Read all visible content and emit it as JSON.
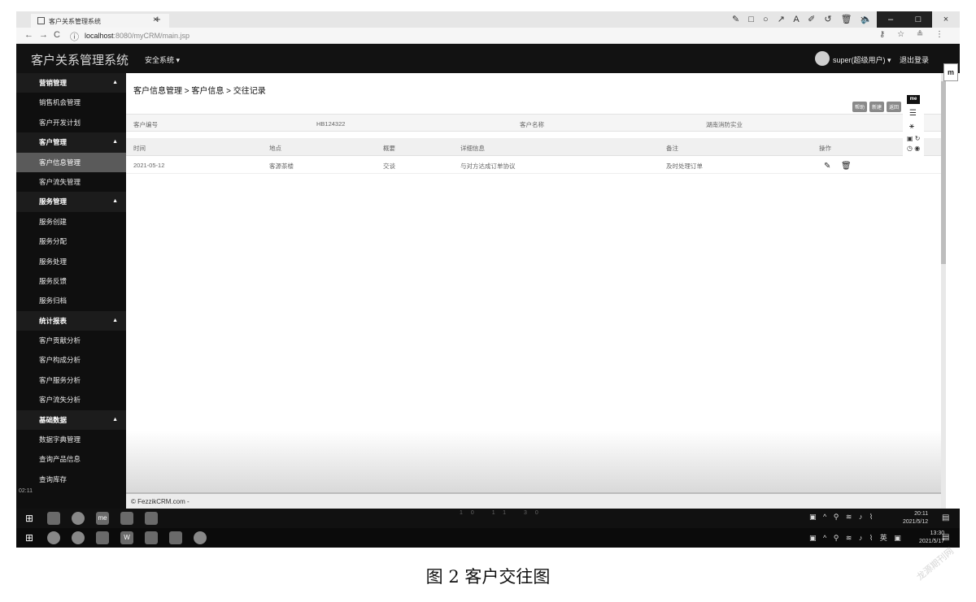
{
  "browser": {
    "tab_title": "客户关系管理系统",
    "tab_close": "×",
    "new_tab": "+",
    "annotation_tools": "✎ □ ○ ↗ A ✐ ↺ 🗑 🔈 🎙",
    "window_controls": [
      "×",
      "–",
      "□",
      "×"
    ],
    "nav": {
      "back": "←",
      "forward": "→",
      "reload": "C",
      "info": "ⓘ"
    },
    "url_host": "localhost",
    "url_rest": ":8080/myCRM/main.jsp",
    "addr_right_icons": "⚷ ☆ ≗ ⋮"
  },
  "app": {
    "title": "客户关系管理系统",
    "system_menu": "安全系统 ▾",
    "user": "super(超级用户) ▾",
    "logout": "退出登录"
  },
  "sidebar": {
    "items": [
      {
        "label": "营销管理",
        "group": true
      },
      {
        "label": "销售机会管理"
      },
      {
        "label": "客户开发计划"
      },
      {
        "label": "客户管理",
        "group": true
      },
      {
        "label": "客户信息管理",
        "active": true
      },
      {
        "label": "客户流失管理"
      },
      {
        "label": "服务管理",
        "group": true
      },
      {
        "label": "服务创建"
      },
      {
        "label": "服务分配"
      },
      {
        "label": "服务处理"
      },
      {
        "label": "服务反馈"
      },
      {
        "label": "服务归档"
      },
      {
        "label": "统计报表",
        "group": true
      },
      {
        "label": "客户贡献分析"
      },
      {
        "label": "客户构成分析"
      },
      {
        "label": "客户服务分析"
      },
      {
        "label": "客户流失分析"
      },
      {
        "label": "基础数据",
        "group": true
      },
      {
        "label": "数据字典管理"
      },
      {
        "label": "查询产品信息"
      },
      {
        "label": "查询库存"
      }
    ]
  },
  "main": {
    "breadcrumb": "客户信息管理 > 客户信息 > 交往记录",
    "action_buttons": [
      "帮助",
      "新建",
      "返回"
    ],
    "info": {
      "customer_no_label": "客户编号",
      "customer_no": "HB124322",
      "customer_name_label": "客户名称",
      "customer_name": "湖南消防实业"
    },
    "table": {
      "headers": [
        "时间",
        "地点",
        "概要",
        "详细信息",
        "备注",
        "操作"
      ],
      "rows": [
        [
          "2021-05-12",
          "客源茶楼",
          "交谈",
          "与对方达成订单协议",
          "及时处理订单"
        ]
      ],
      "edit_icon": "✎",
      "delete_icon": "🗑"
    },
    "footer": "© FezzikCRM.com -"
  },
  "floating_toolbar": {
    "logo": "me",
    "m_tag": "m"
  },
  "left_clock": "02:11",
  "taskbar_top": {
    "mid_text": "10 11 30",
    "time": "20:11",
    "date": "2021/5/12"
  },
  "taskbar_bottom": {
    "time": "13:30",
    "date": "2021/5/17",
    "ime": "英"
  },
  "caption": "图 2   客户交往图",
  "watermark": "龙源期刊网"
}
